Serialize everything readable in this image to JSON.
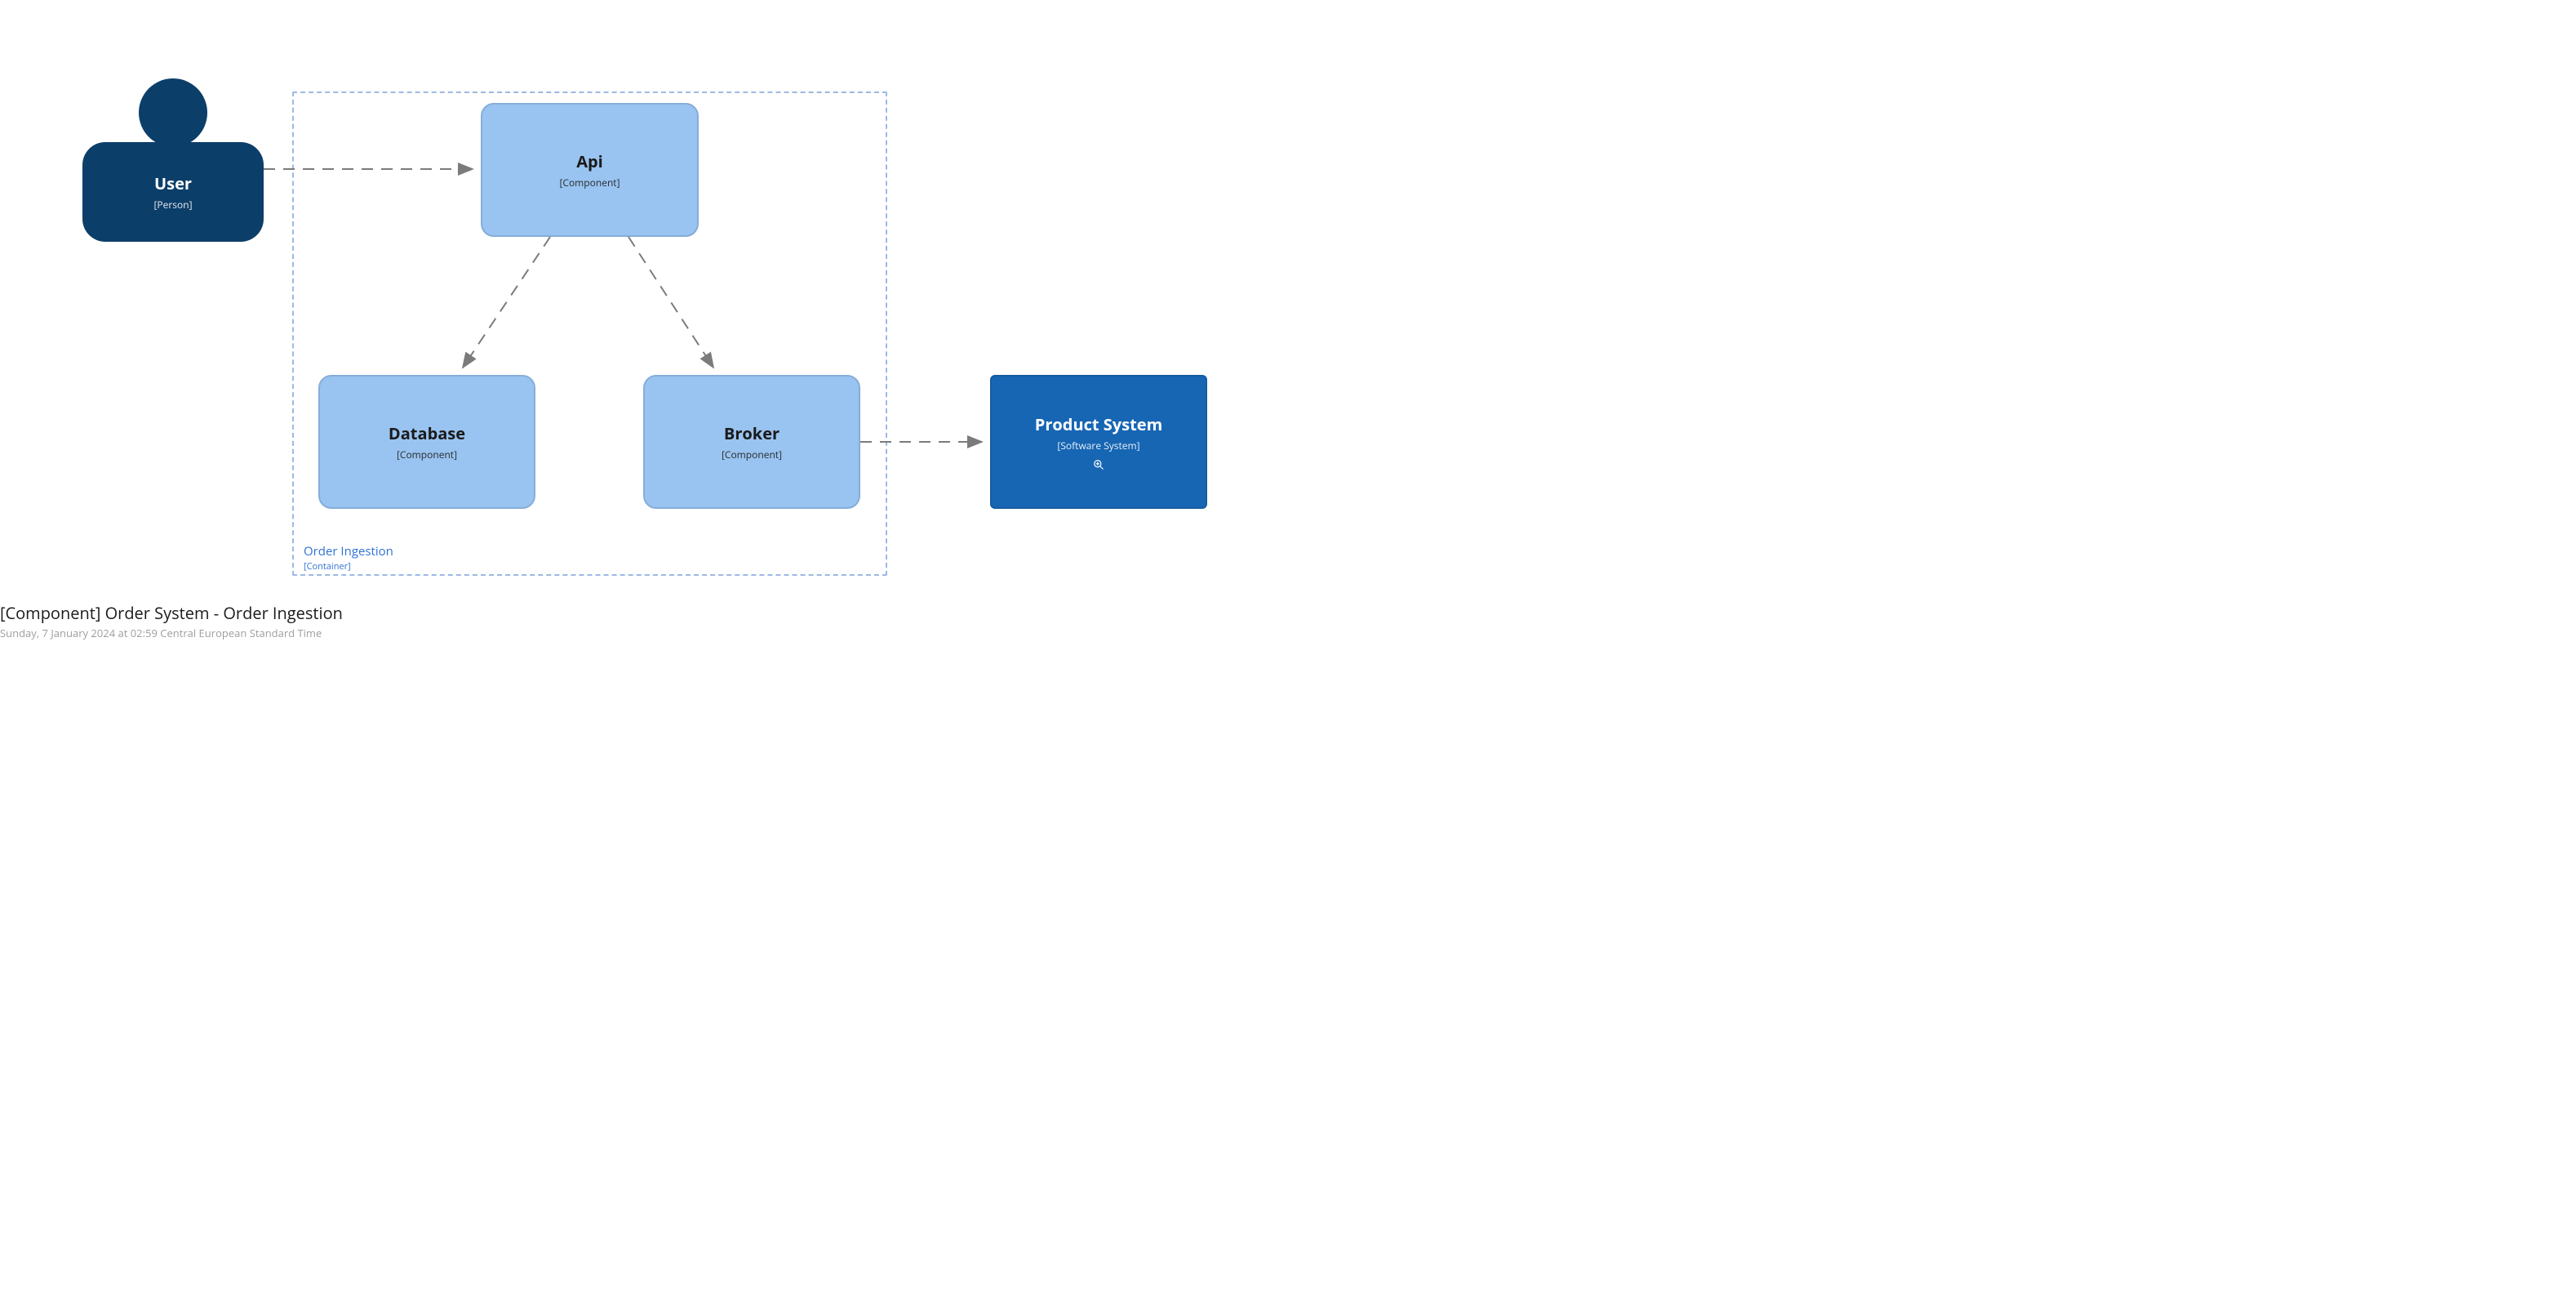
{
  "diagram": {
    "person": {
      "name": "User",
      "stereo": "[Person]"
    },
    "container": {
      "name": "Order Ingestion",
      "stereo": "[Container]"
    },
    "api": {
      "name": "Api",
      "stereo": "[Component]"
    },
    "database": {
      "name": "Database",
      "stereo": "[Component]"
    },
    "broker": {
      "name": "Broker",
      "stereo": "[Component]"
    },
    "product": {
      "name": "Product System",
      "stereo": "[Software System]"
    }
  },
  "footer": {
    "title": "[Component] Order System - Order Ingestion",
    "subtitle": "Sunday, 7 January 2024 at 02:59 Central European Standard Time"
  },
  "colors": {
    "person_fill": "#0c3e6a",
    "container_border": "#9db9e3",
    "component_fill": "#99c3f0",
    "component_border": "#86add8",
    "system_fill": "#1766b4",
    "system_border": "#145c9f",
    "arrow": "#7b7b7b"
  }
}
